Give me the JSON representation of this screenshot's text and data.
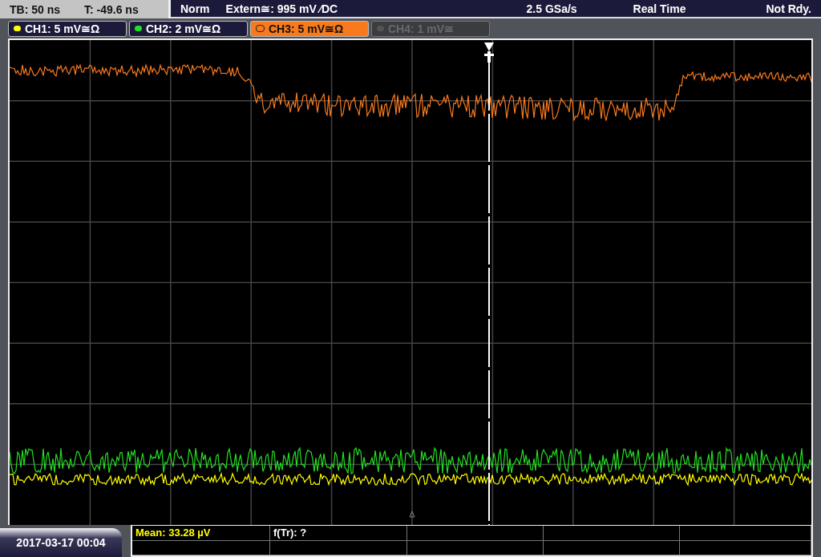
{
  "header": {
    "timebase": "TB: 50 ns",
    "trigger_time": "T: -49.6 ns",
    "trigger_mode": "Norm",
    "trigger_source": "Extern≅: 995 mV ⁄DC",
    "sample_rate": "2.5 GSa/s",
    "acquisition": "Real Time",
    "status": "Not Rdy."
  },
  "channels": [
    {
      "label": "CH1: 5 mV≅Ω",
      "color": "#ffff00",
      "selected": false,
      "disabled": false
    },
    {
      "label": "CH2: 2 mV≅Ω",
      "color": "#22e022",
      "selected": false,
      "disabled": false
    },
    {
      "label": "CH3: 5 mV≅Ω",
      "color": "#f97a1c",
      "selected": true,
      "disabled": false
    },
    {
      "label": "CH4: 1 mV≅",
      "color": "#555555",
      "selected": false,
      "disabled": true
    }
  ],
  "date": "2017-03-17 00:04",
  "measurements": [
    "Mean: 33.28 µV",
    "f(Tr): ?"
  ]
}
